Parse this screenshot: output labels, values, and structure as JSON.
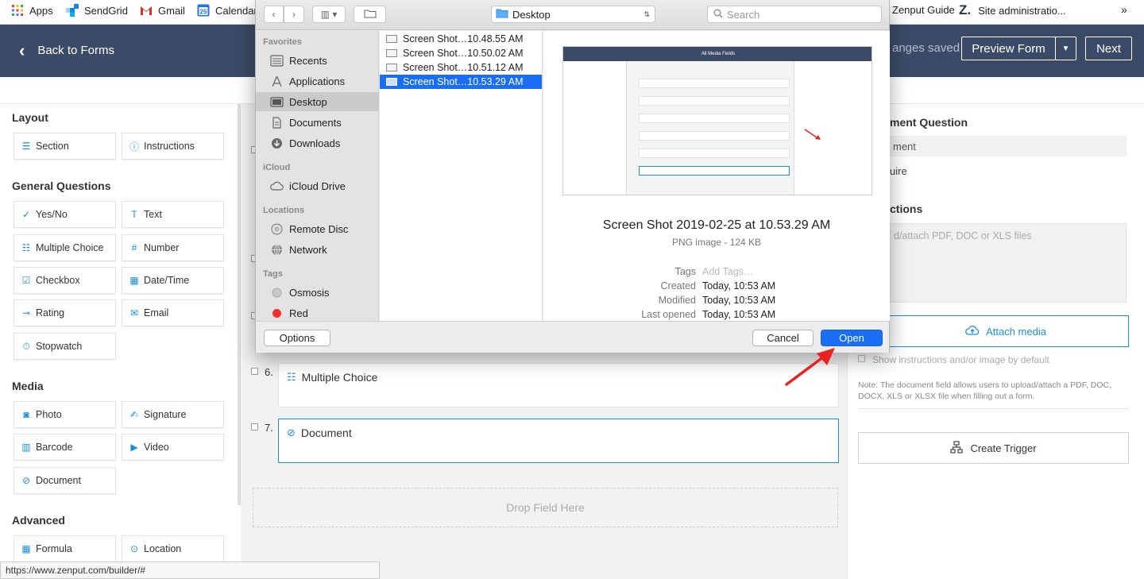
{
  "bookmarks": [
    {
      "label": "Apps",
      "icon": "apps-grid-icon"
    },
    {
      "label": "SendGrid",
      "icon": "sendgrid-icon"
    },
    {
      "label": "Gmail",
      "icon": "gmail-icon"
    },
    {
      "label": "Calendar",
      "icon": "calendar-icon"
    },
    {
      "label": "Zenput Guide",
      "icon": "zenput-icon"
    },
    {
      "label": "Site administratio...",
      "icon": "zenput-z-icon"
    }
  ],
  "header": {
    "back_label": "Back to Forms",
    "saved_text": "anges saved",
    "preview_label": "Preview Form",
    "next_label": "Next"
  },
  "palette": {
    "sections": [
      {
        "title": "Layout",
        "items": [
          {
            "label": "Section",
            "icon": "section-icon"
          },
          {
            "label": "Instructions",
            "icon": "info-icon"
          }
        ]
      },
      {
        "title": "General Questions",
        "items": [
          {
            "label": "Yes/No",
            "icon": "yes-no-icon"
          },
          {
            "label": "Text",
            "icon": "text-icon"
          },
          {
            "label": "Multiple Choice",
            "icon": "multiple-choice-icon"
          },
          {
            "label": "Number",
            "icon": "hash-icon"
          },
          {
            "label": "Checkbox",
            "icon": "checkbox-icon"
          },
          {
            "label": "Date/Time",
            "icon": "calendar-icon"
          },
          {
            "label": "Rating",
            "icon": "rating-icon"
          },
          {
            "label": "Email",
            "icon": "email-icon"
          },
          {
            "label": "Stopwatch",
            "icon": "stopwatch-icon"
          }
        ]
      },
      {
        "title": "Media",
        "items": [
          {
            "label": "Photo",
            "icon": "camera-icon"
          },
          {
            "label": "Signature",
            "icon": "signature-icon"
          },
          {
            "label": "Barcode",
            "icon": "barcode-icon"
          },
          {
            "label": "Video",
            "icon": "video-icon"
          },
          {
            "label": "Document",
            "icon": "paperclip-icon"
          }
        ]
      },
      {
        "title": "Advanced",
        "items": [
          {
            "label": "Formula",
            "icon": "formula-icon"
          },
          {
            "label": "Location",
            "icon": "location-icon"
          }
        ]
      }
    ]
  },
  "canvas": {
    "questions": [
      {
        "num": "6.",
        "label": "Multiple Choice",
        "icon": "multiple-choice-icon"
      },
      {
        "num": "7.",
        "label": "Document",
        "icon": "paperclip-icon"
      }
    ],
    "drop_label": "Drop Field Here"
  },
  "right_panel": {
    "title": "ment Question",
    "name_value": "ment",
    "require_label": "uire",
    "instructions_title": "ctions",
    "instructions_placeholder": "d/attach PDF, DOC or XLS files",
    "attach_label": "Attach media",
    "show_default_label": "Show instructions and/or image by default",
    "note": "Note: The document field allows users to upload/attach a PDF, DOC, DOCX, XLS or XLSX file when filling out a form.",
    "trigger_label": "Create Trigger"
  },
  "dialog": {
    "location": "Desktop",
    "search_placeholder": "Search",
    "sidebar": {
      "favorites_title": "Favorites",
      "favorites": [
        {
          "label": "Recents",
          "icon": "recents-icon"
        },
        {
          "label": "Applications",
          "icon": "applications-icon"
        },
        {
          "label": "Desktop",
          "icon": "desktop-icon"
        },
        {
          "label": "Documents",
          "icon": "documents-icon"
        },
        {
          "label": "Downloads",
          "icon": "downloads-icon"
        }
      ],
      "icloud_title": "iCloud",
      "icloud": [
        {
          "label": "iCloud Drive",
          "icon": "cloud-icon"
        }
      ],
      "locations_title": "Locations",
      "locations": [
        {
          "label": "Remote Disc",
          "icon": "disc-icon"
        },
        {
          "label": "Network",
          "icon": "network-icon"
        }
      ],
      "tags_title": "Tags",
      "tags": [
        {
          "label": "Osmosis",
          "color": "#c8c8c8"
        },
        {
          "label": "Red",
          "color": "#f2302c"
        }
      ]
    },
    "files": [
      {
        "name": "Screen Shot…10.48.55 AM"
      },
      {
        "name": "Screen Shot…10.50.02 AM"
      },
      {
        "name": "Screen Shot…10.51.12 AM"
      },
      {
        "name": "Screen Shot…10.53.29 AM"
      }
    ],
    "preview": {
      "thumb_title": "All Media Fields",
      "title": "Screen Shot 2019-02-25 at 10.53.29 AM",
      "kind": "PNG image - 124 KB",
      "tags_label": "Tags",
      "tags_placeholder": "Add Tags…",
      "created_label": "Created",
      "created_value": "Today, 10:53 AM",
      "modified_label": "Modified",
      "modified_value": "Today, 10:53 AM",
      "opened_label": "Last opened",
      "opened_value": "Today, 10:53 AM"
    },
    "options_label": "Options",
    "cancel_label": "Cancel",
    "open_label": "Open"
  },
  "status_url": "https://www.zenput.com/builder/#",
  "colors": {
    "header": "#3b4a67",
    "accent": "#1e8ed1",
    "open_button": "#1a6df5",
    "arrow": "#e8231f"
  }
}
